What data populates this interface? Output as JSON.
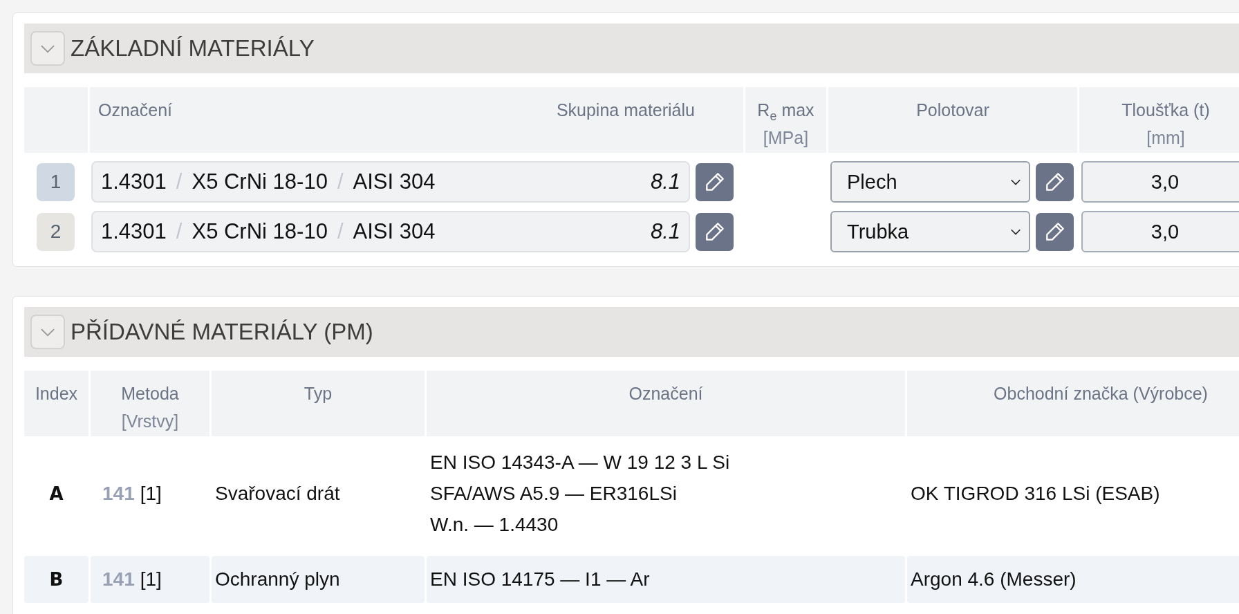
{
  "base_materials": {
    "title": "ZÁKLADNÍ MATERIÁLY",
    "expanded": true,
    "columns": [
      {
        "label": "Označení",
        "secondary": "Skupina materiálu"
      },
      {
        "label": "R$_{e}$ max",
        "unit": "[MPa]"
      },
      {
        "label": "Polotovar"
      },
      {
        "label": "Tloušťka (t)",
        "unit": "[mm]"
      }
    ],
    "rows": [
      {
        "index": "1",
        "color": "#cfd8e3",
        "designations": [
          "1.4301",
          "X5 CrNi 18-10",
          "AISI 304"
        ],
        "separator": "/",
        "group": "8.1",
        "semi_product": "Plech",
        "thickness": "3,0"
      },
      {
        "index": "2",
        "color": "#e6e5e2",
        "designations": [
          "1.4301",
          "X5 CrNi 18-10",
          "AISI 304"
        ],
        "separator": "/",
        "group": "8.1",
        "semi_product": "Trubka",
        "thickness": "3,0"
      }
    ]
  },
  "filler_materials": {
    "title": "PŘÍDAVNÉ MATERIÁLY (PM)",
    "expanded": true,
    "columns": [
      {
        "label": "Index"
      },
      {
        "label": "Metoda",
        "unit": "[Vrstvy]"
      },
      {
        "label": "Typ"
      },
      {
        "label": "Označení"
      },
      {
        "label": "Obchodní značka (Výrobce)"
      }
    ],
    "rows": [
      {
        "index": "A",
        "selected": false,
        "method": "141",
        "layers": "[1]",
        "type": "Svařovací drát",
        "designations": [
          "EN ISO 14343-A — W 19 12 3 L Si",
          "SFA/AWS A5.9 — ER316LSi",
          "W.n. — 1.4430"
        ],
        "brand": "OK TIGROD 316 LSi (ESAB)"
      },
      {
        "index": "B",
        "selected": true,
        "method": "141",
        "layers": "[1]",
        "type": "Ochranný plyn",
        "designations": [
          "EN ISO 14175 — I1 — Ar"
        ],
        "brand": "Argon 4.6 (Messer)"
      }
    ]
  }
}
